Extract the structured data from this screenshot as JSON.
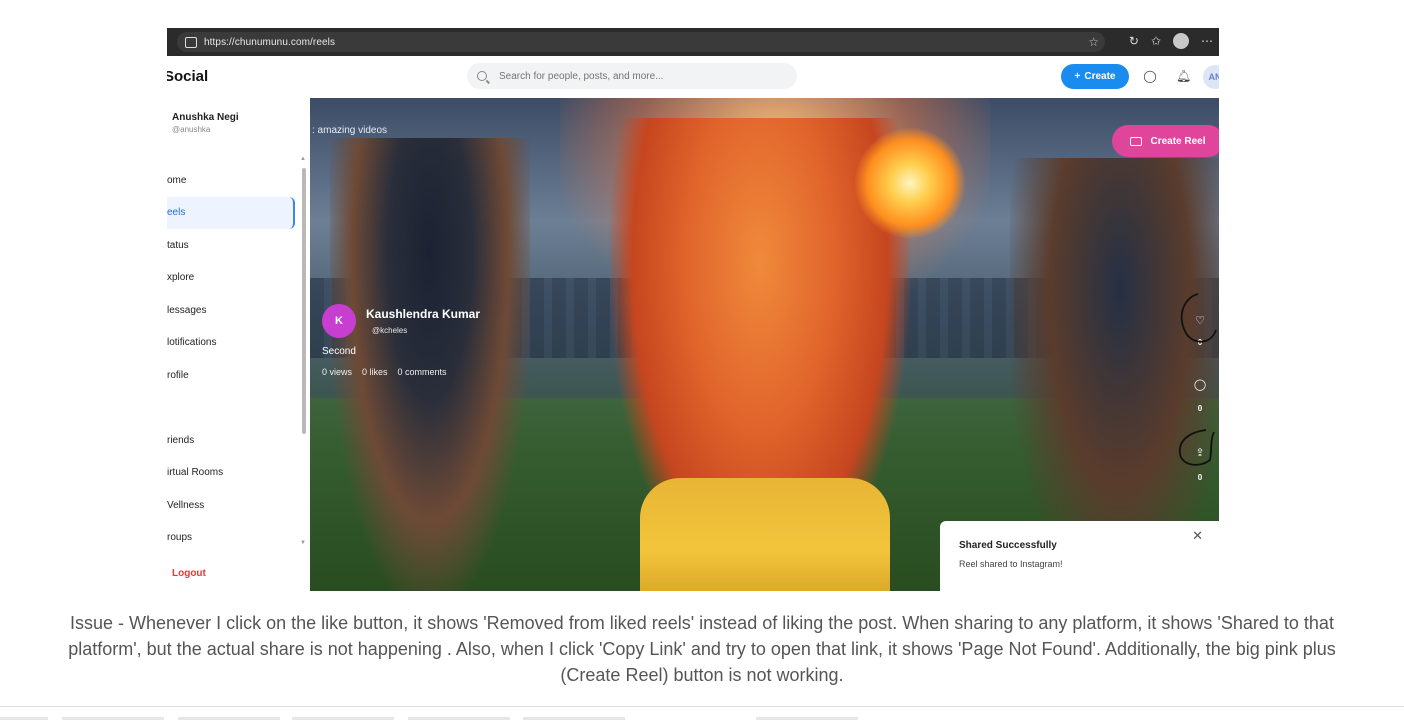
{
  "browser": {
    "url": "https://chunumunu.com/reels"
  },
  "app": {
    "brand": "Social",
    "search_placeholder": "Search for people, posts, and more...",
    "create_label": "Create",
    "avatar_initials": "AN"
  },
  "user": {
    "name": "Anushka Negi",
    "handle": "@anushka"
  },
  "sidebar": {
    "items": [
      {
        "label": "ome"
      },
      {
        "label": "eels"
      },
      {
        "label": "tatus"
      },
      {
        "label": "xplore"
      },
      {
        "label": "lessages"
      },
      {
        "label": "lotifications"
      },
      {
        "label": "rofile"
      },
      {
        "label": ""
      },
      {
        "label": "riends"
      },
      {
        "label": "irtual Rooms"
      },
      {
        "label": "Vellness"
      },
      {
        "label": "roups"
      }
    ],
    "logout": "Logout"
  },
  "reel": {
    "caption_tag": ": amazing videos",
    "create_reel_label": "Create Reel",
    "author_initial": "K",
    "author_name": "Kaushlendra Kumar",
    "author_handle": "@kcheles",
    "description": "Second",
    "views": "0 views",
    "likes": "0 likes",
    "comments": "0 comments",
    "like_count": "0",
    "comment_count": "0",
    "share_count": "0"
  },
  "toast": {
    "title": "Shared Successfully",
    "message": "Reel shared to Instagram!"
  },
  "issue_text": "Issue - Whenever I click on the like button, it shows 'Removed from liked reels' instead of liking the post. When sharing to any platform, it shows 'Shared to that platform', but the actual share is not happening . Also, when I click 'Copy Link' and try to open that link, it shows 'Page Not Found'. Additionally, the big pink plus (Create Reel) button is not working."
}
